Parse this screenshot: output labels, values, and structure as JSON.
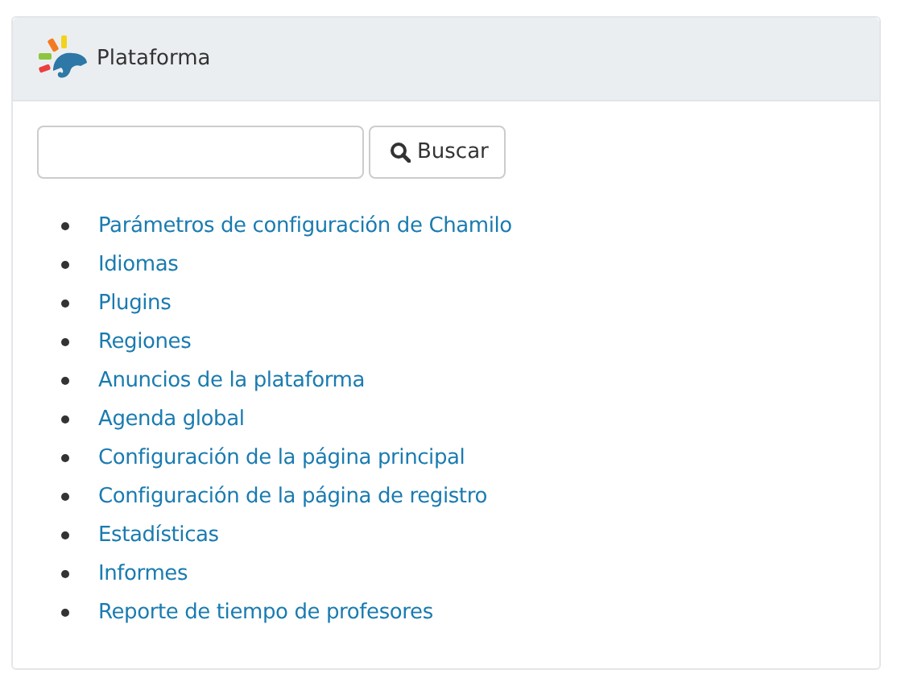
{
  "panel": {
    "title": "Plataforma"
  },
  "search": {
    "button": "Buscar"
  },
  "links": [
    "Parámetros de configuración de Chamilo",
    "Idiomas",
    "Plugins",
    "Regiones",
    "Anuncios de la plataforma",
    "Agenda global",
    "Configuración de la página principal",
    "Configuración de la página de registro",
    "Estadísticas",
    "Informes",
    "Reporte de tiempo de profesores"
  ]
}
